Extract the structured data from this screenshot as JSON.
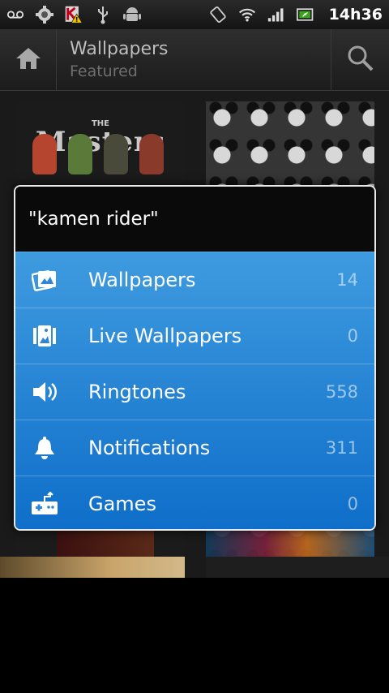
{
  "status_bar": {
    "time": "14h36",
    "icons": [
      "voicemail-icon",
      "settings-icon",
      "kaspersky-warning-icon",
      "usb-icon",
      "android-debug-icon",
      "rotate-icon",
      "wifi-icon",
      "signal-icon",
      "battery-icon"
    ]
  },
  "action_bar": {
    "title": "Wallpapers",
    "subtitle": "Featured",
    "home_icon": "home-icon",
    "search_icon": "search-icon"
  },
  "background": {
    "thumb_left_text": "Masters",
    "thumb_left_small": "THE"
  },
  "dialog": {
    "title": "\"kamen rider\"",
    "items": [
      {
        "label": "Wallpapers",
        "count": "14",
        "icon": "wallpaper-icon"
      },
      {
        "label": "Live Wallpapers",
        "count": "0",
        "icon": "live-wallpaper-icon"
      },
      {
        "label": "Ringtones",
        "count": "558",
        "icon": "speaker-icon"
      },
      {
        "label": "Notifications",
        "count": "311",
        "icon": "bell-icon"
      },
      {
        "label": "Games",
        "count": "0",
        "icon": "gamepad-icon"
      }
    ]
  },
  "colors": {
    "list_top": "#3f9bdf",
    "list_bottom": "#0e6ec9",
    "action_bar": "#262626"
  }
}
